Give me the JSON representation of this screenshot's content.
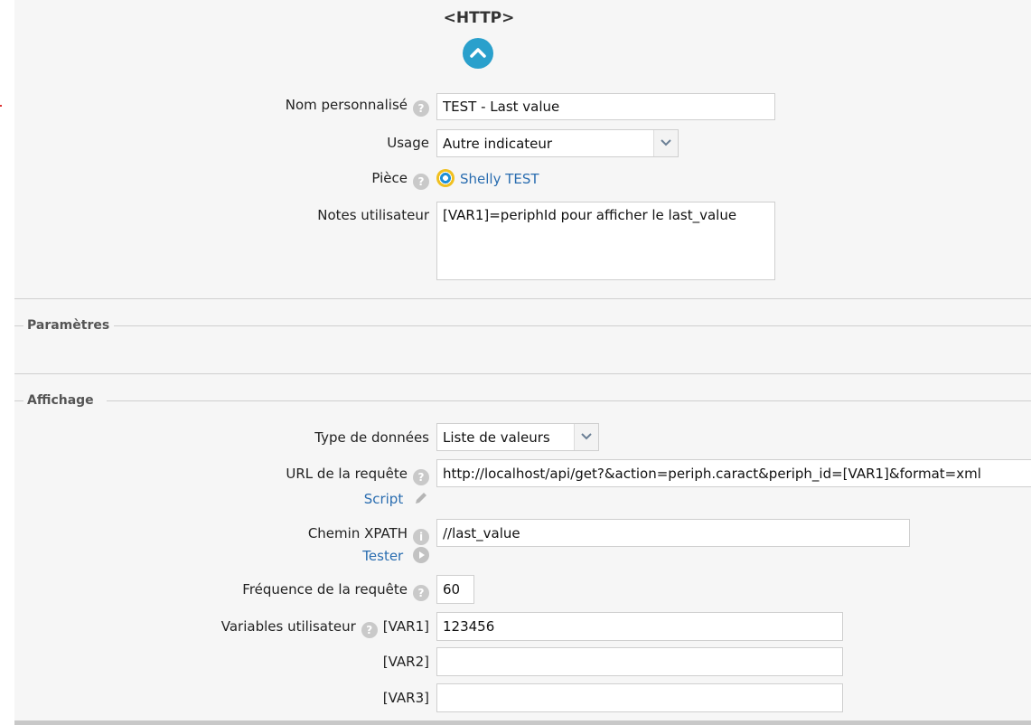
{
  "header": {
    "title": "<HTTP>"
  },
  "form": {
    "name": {
      "label": "Nom personnalisé",
      "value": "TEST - Last value"
    },
    "usage": {
      "label": "Usage",
      "value": "Autre indicateur"
    },
    "room": {
      "label": "Pièce",
      "value": "Shelly TEST"
    },
    "notes": {
      "label": "Notes utilisateur",
      "value": "[VAR1]=periphId pour afficher le last_value"
    }
  },
  "sections": {
    "params": "Paramètres",
    "display": "Affichage"
  },
  "display": {
    "data_type": {
      "label": "Type de données",
      "value": "Liste de valeurs"
    },
    "url": {
      "label": "URL de la requête",
      "value": "http://localhost/api/get?&action=periph.caract&periph_id=[VAR1]&format=xml",
      "script_link": "Script"
    },
    "xpath": {
      "label": "Chemin XPATH",
      "value": "//last_value",
      "tester_link": "Tester"
    },
    "frequency": {
      "label": "Fréquence de la requête",
      "value": "60"
    },
    "variables": {
      "label": "Variables utilisateur",
      "var1": {
        "label": "[VAR1]",
        "value": "123456"
      },
      "var2": {
        "label": "[VAR2]",
        "value": ""
      },
      "var3": {
        "label": "[VAR3]",
        "value": ""
      }
    }
  },
  "colors": {
    "accent": "#2aa0cc",
    "link": "#2a6db0",
    "panel_bg": "#f6f6f6"
  },
  "icons": {
    "collapse": "chevron-up-icon",
    "help": "help-icon",
    "info": "info-icon",
    "room": "room-icon",
    "script": "pencil-icon",
    "tester": "play-icon"
  }
}
